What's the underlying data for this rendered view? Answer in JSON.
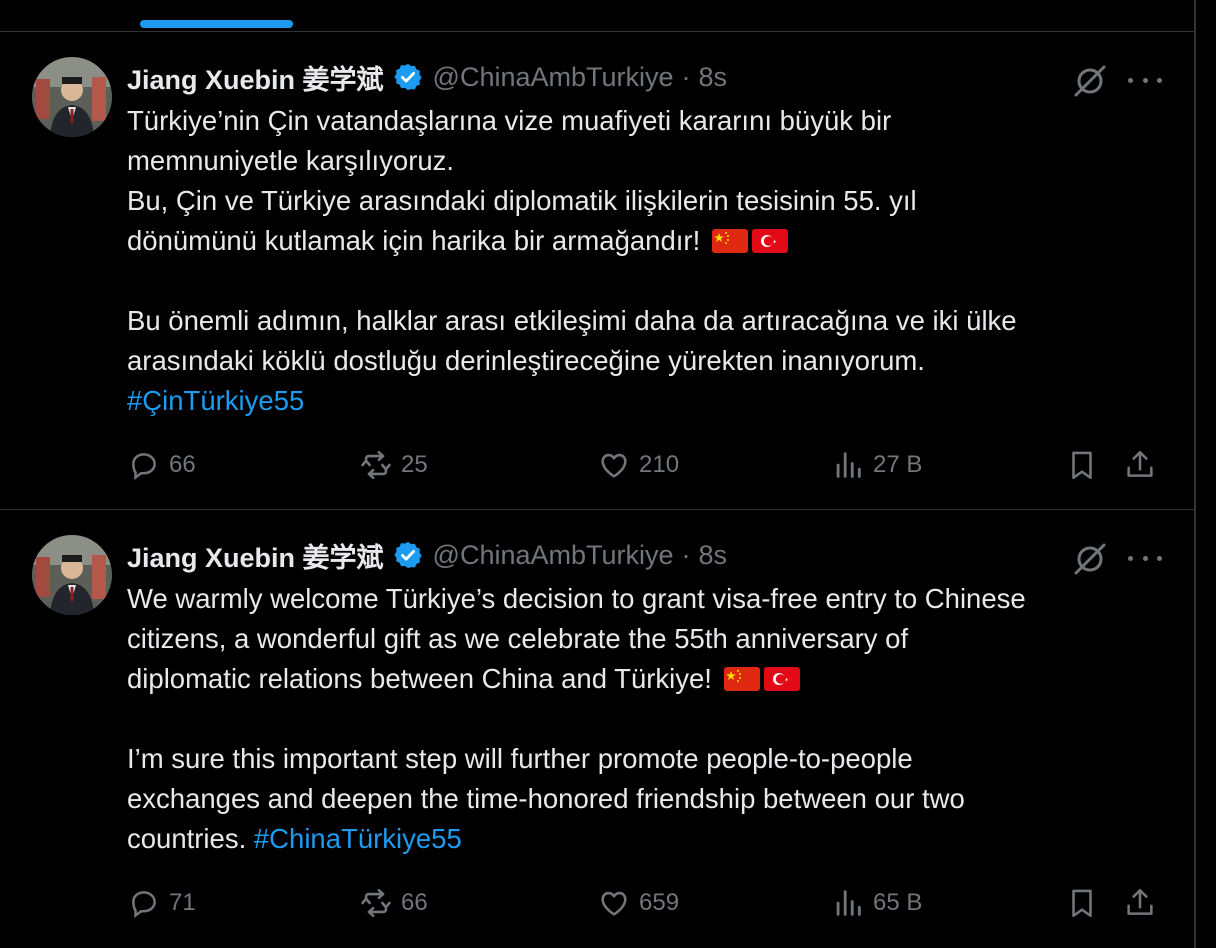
{
  "tweets": [
    {
      "author_name": "Jiang Xuebin 姜学斌",
      "handle": "@ChinaAmbTurkiye",
      "separator": "·",
      "time": "8s",
      "paragraphs": [
        {
          "lines": [
            "Türkiye’nin Çin vatandaşlarına vize muafiyeti kararını büyük bir",
            "memnuniyetle karşılıyoruz.",
            "Bu, Çin ve Türkiye arasındaki diplomatik ilişkilerin tesisinin 55. yıl"
          ],
          "last_line": "dönümünü kutlamak için harika bir armağandır!"
        },
        {
          "lines": [
            "Bu önemli adımın, halklar arası etkileşimi daha da artıracağına ve iki ülke",
            "arasındaki köklü dostluğu derinleştireceğine yürekten inanıyorum."
          ],
          "hashtag_prefix": "",
          "hashtag": "#ÇinTürkiye55"
        }
      ],
      "stats": {
        "replies": "66",
        "reposts": "25",
        "likes": "210",
        "views": "27 B"
      }
    },
    {
      "author_name": "Jiang Xuebin 姜学斌",
      "handle": "@ChinaAmbTurkiye",
      "separator": "·",
      "time": "8s",
      "paragraphs": [
        {
          "lines": [
            "We warmly welcome Türkiye’s decision to grant visa-free entry to Chinese",
            "citizens, a wonderful gift as we celebrate the 55th anniversary of"
          ],
          "last_line": "diplomatic relations between China and Türkiye!"
        },
        {
          "lines": [
            "I’m sure this important step will further promote people-to-people",
            "exchanges and deepen the time-honored friendship between our two"
          ],
          "hashtag_prefix": "countries.",
          "hashtag": "#ChinaTürkiye55"
        }
      ],
      "stats": {
        "replies": "71",
        "reposts": "66",
        "likes": "659",
        "views": "65 B"
      }
    }
  ],
  "icons": {
    "verified": "verified-badge-icon",
    "grok": "grok-icon",
    "more": "more-icon",
    "reply": "reply-icon",
    "repost": "repost-icon",
    "like": "like-icon",
    "views": "views-icon",
    "bookmark": "bookmark-icon",
    "share": "share-icon"
  },
  "colors": {
    "background": "#000000",
    "text": "#e7e9ea",
    "secondary": "#71767b",
    "accent": "#1d9bf0",
    "divider": "#2f3336"
  }
}
